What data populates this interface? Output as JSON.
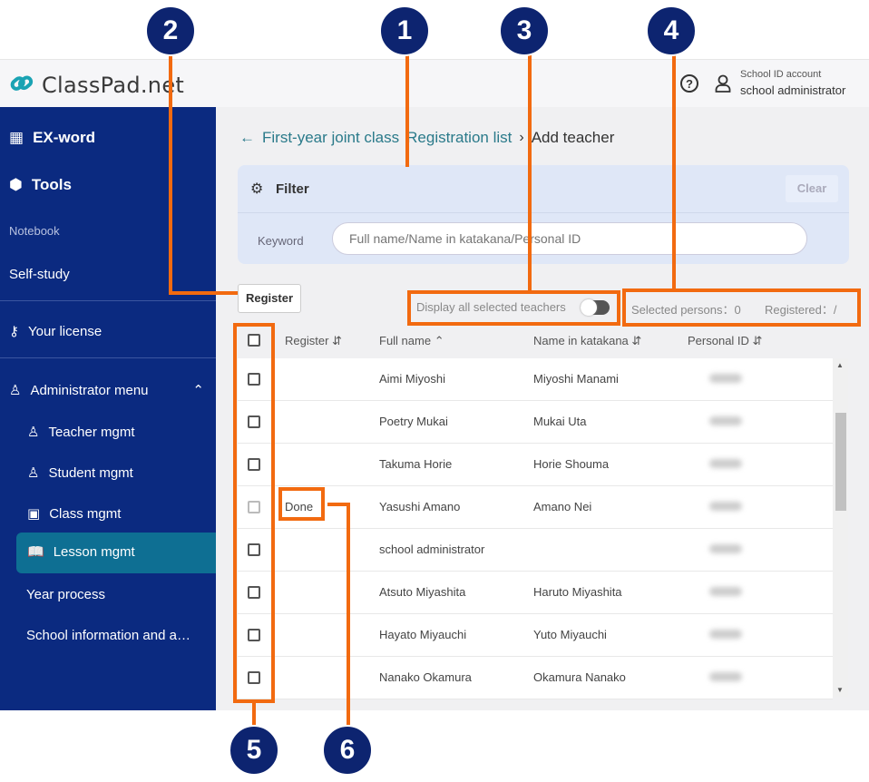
{
  "app": {
    "logo": "ClassPad.net",
    "help_icon": "question-circle-icon",
    "account_label": "School ID account",
    "account_name": "school administrator"
  },
  "sidebar": {
    "items": [
      {
        "label": "EX-word",
        "icon": "dictionary-icon"
      },
      {
        "label": "Tools",
        "icon": "box-icon"
      },
      {
        "label": "Notebook"
      },
      {
        "label": "Self-study"
      },
      {
        "label": "Your license",
        "icon": "key-icon"
      },
      {
        "label": "Administrator menu",
        "icon": "admin-user-icon"
      },
      {
        "label": "Teacher mgmt",
        "icon": "teacher-icon"
      },
      {
        "label": "Student mgmt",
        "icon": "user-icon"
      },
      {
        "label": "Class mgmt",
        "icon": "class-icon"
      },
      {
        "label": "Lesson mgmt",
        "icon": "book-icon",
        "active": true
      },
      {
        "label": "Year process"
      },
      {
        "label": "School information and a…"
      }
    ]
  },
  "breadcrumb": {
    "items": [
      "First-year joint class",
      "Registration list"
    ],
    "current": "Add teacher"
  },
  "filter": {
    "title": "Filter",
    "clear": "Clear",
    "keyword_label": "Keyword",
    "placeholder": "Full name/Name in katakana/Personal ID"
  },
  "actions": {
    "register": "Register",
    "toggle_label": "Display all selected teachers",
    "toggle_on": false,
    "selected": "Selected persons：0",
    "registered": "Registered：/"
  },
  "table": {
    "columns": [
      "Register",
      "Full name",
      "Name in katakana",
      "Personal ID"
    ],
    "rows": [
      {
        "register": "",
        "full_name": "Aimi Miyoshi",
        "katakana": "Miyoshi Manami"
      },
      {
        "register": "",
        "full_name": "Poetry Mukai",
        "katakana": "Mukai Uta"
      },
      {
        "register": "",
        "full_name": "Takuma Horie",
        "katakana": "Horie Shouma"
      },
      {
        "register": "Done",
        "full_name": "Yasushi Amano",
        "katakana": "Amano Nei"
      },
      {
        "register": "",
        "full_name": "school administrator",
        "katakana": ""
      },
      {
        "register": "",
        "full_name": "Atsuto Miyashita",
        "katakana": "Haruto Miyashita"
      },
      {
        "register": "",
        "full_name": "Hayato Miyauchi",
        "katakana": "Yuto Miyauchi"
      },
      {
        "register": "",
        "full_name": "Nanako Okamura",
        "katakana": "Okamura Nanako"
      }
    ]
  },
  "callouts": [
    "1",
    "2",
    "3",
    "4",
    "5",
    "6"
  ],
  "colors": {
    "sidebar": "#0b2a80",
    "active": "#0e6f93",
    "callout": "#0d2470",
    "highlight": "#f26a10"
  }
}
